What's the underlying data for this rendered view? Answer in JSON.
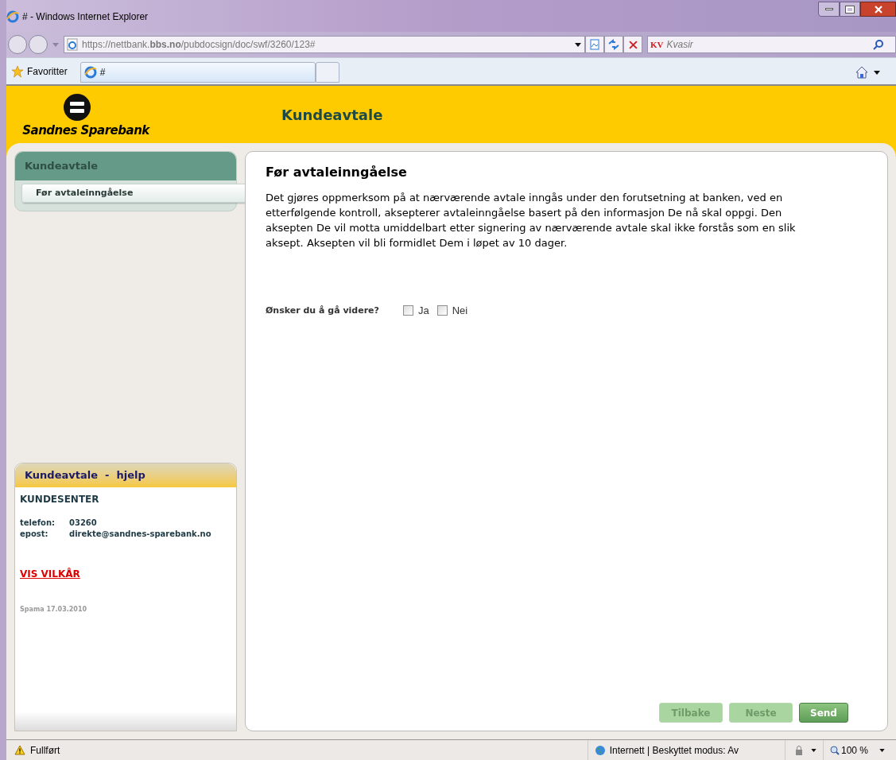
{
  "window": {
    "title": "# - Windows Internet Explorer"
  },
  "address_bar": {
    "url": "https://nettbank.**bbs.no**/pubdocsign/doc/swf/3260/123#"
  },
  "search": {
    "provider": "KV",
    "placeholder": "Kvasir"
  },
  "favorites": {
    "label": "Favoritter"
  },
  "tabs": [
    {
      "label": "#",
      "selected": true
    }
  ],
  "page": {
    "brand": "Sandnes Sparebank",
    "header_title": "Kundeavtale",
    "sidebar": {
      "title": "Kundeavtale",
      "items": [
        {
          "label": "Før avtaleinngåelse",
          "selected": true
        }
      ]
    },
    "help": {
      "title": "Kundeavtale  -  hjelp",
      "heading": "KUNDESENTER",
      "contacts": [
        {
          "label": "telefon:",
          "value": "03260"
        },
        {
          "label": "epost:",
          "value": "direkte@sandnes-sparebank.no"
        }
      ],
      "link": "VIS VILKÅR",
      "footnote": "Spama 17.03.2010"
    },
    "content": {
      "heading": "Før avtaleinngåelse",
      "paragraph": "Det gjøres oppmerksom på at nærværende avtale inngås under den forutsetning at banken, ved en etterfølgende kontroll, aksepterer avtaleinngåelse basert på den informasjon De nå skal oppgi. Den aksepten De vil motta umiddelbart etter signering av nærværende avtale skal ikke forstås som en slik aksept. Aksepten vil bli formidlet Dem i løpet av 10 dager.",
      "question": "Ønsker du å gå videre?",
      "options": [
        {
          "label": "Ja",
          "checked": false
        },
        {
          "label": "Nei",
          "checked": false
        }
      ],
      "buttons": [
        {
          "label": "Tilbake",
          "disabled": true
        },
        {
          "label": "Neste",
          "disabled": true
        },
        {
          "label": "Send",
          "disabled": false
        }
      ]
    }
  },
  "status_bar": {
    "text": "Fullført",
    "zone": "Internett | Beskyttet modus: Av",
    "zoom": "100 %"
  }
}
